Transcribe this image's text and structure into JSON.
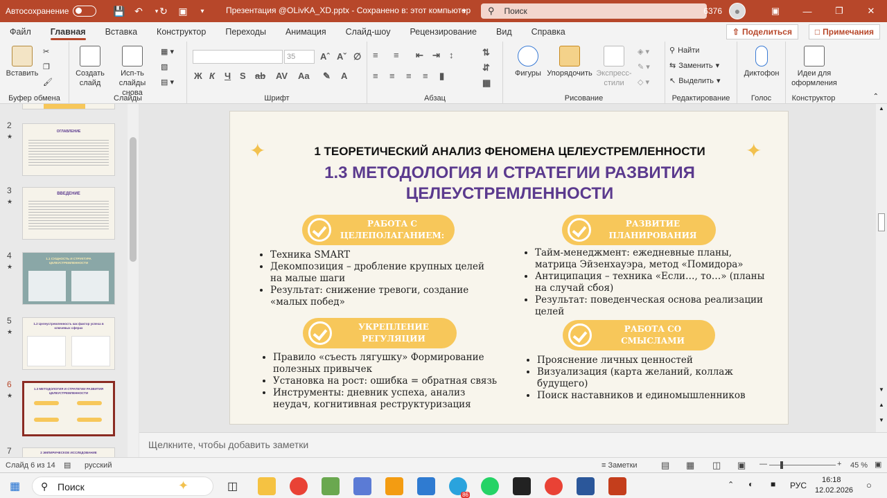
{
  "titlebar": {
    "autosave_label": "Автосохранение",
    "doc_title": "Презентация @OLivKA_XD.pptx  -  Сохранено в: этот компьютер",
    "search_placeholder": "Поиск",
    "user_id": "6376"
  },
  "menu": {
    "tabs": [
      "Файл",
      "Главная",
      "Вставка",
      "Конструктор",
      "Переходы",
      "Анимация",
      "Слайд-шоу",
      "Рецензирование",
      "Вид",
      "Справка"
    ],
    "share_label": "Поделиться",
    "notes_label": "Примечания"
  },
  "ribbon": {
    "clipboard": {
      "paste": "Вставить",
      "group": "Буфер обмена"
    },
    "slides": {
      "create": "Создать слайд",
      "reuse": "Исп-ть слайды снова",
      "group": "Слайды"
    },
    "font": {
      "size": "35",
      "group": "Шрифт"
    },
    "paragraph": {
      "group": "Абзац"
    },
    "drawing": {
      "shapes": "Фигуры",
      "arrange": "Упорядочить",
      "styles": "Экспресс-стили",
      "group": "Рисование"
    },
    "editing": {
      "find": "Найти",
      "replace": "Заменить",
      "select": "Выделить",
      "group": "Редактирование"
    },
    "voice": {
      "dictate": "Диктофон",
      "group": "Голос"
    },
    "designer": {
      "ideas": "Идеи для оформления",
      "group": "Конструктор"
    }
  },
  "thumbnails": [
    {
      "num": "2",
      "title": "ОГЛАВЛЕНИЕ"
    },
    {
      "num": "3",
      "title": "ВВЕДЕНИЕ"
    },
    {
      "num": "4",
      "title": "1.1 СУЩНОСТЬ И СТРУКТУРА ЦЕЛЕУСТРЕМЛЕННОСТИ"
    },
    {
      "num": "5",
      "title": "1.2 Целеустремленность как фактор успеха в ключевых сферах"
    },
    {
      "num": "6",
      "title": "1.3 МЕТОДОЛОГИЯ И СТРАТЕГИИ РАЗВИТИЯ ЦЕЛЕУСТРЕМЛЕННОСТИ"
    },
    {
      "num": "7",
      "title": "2 ЭМПИРИЧЕСКОЕ ИССЛЕДОВАНИЕ"
    }
  ],
  "slide": {
    "heading": "1 ТЕОРЕТИЧЕСКИЙ АНАЛИЗ ФЕНОМЕНА ЦЕЛЕУСТРЕМЛЕННОСТИ",
    "subheading_line1": "1.3 МЕТОДОЛОГИЯ И СТРАТЕГИИ РАЗВИТИЯ",
    "subheading_line2": "ЦЕЛЕУСТРЕМЛЕННОСТИ",
    "blocks": [
      {
        "title_l1": "РАБОТА С",
        "title_l2": "ЦЕЛЕПОЛАГАНИЕМ:",
        "items": [
          "Техника SMART",
          "Декомпозиция – дробление крупных целей на малые шаги",
          "Результат: снижение тревоги, создание «малых побед»"
        ]
      },
      {
        "title_l1": "РАЗВИТИЕ",
        "title_l2": "ПЛАНИРОВАНИЯ",
        "items": [
          "Тайм-менеджмент: ежедневные планы, матрица Эйзенхауэра, метод «Помидора»",
          "Антиципация – техника «Если…, то…» (планы на случай сбоя)",
          "Результат: поведенческая основа реализации целей"
        ]
      },
      {
        "title_l1": "УКРЕПЛЕНИЕ",
        "title_l2": "РЕГУЛЯЦИИ",
        "items": [
          "Правило «съесть лягушку» Формирование полезных привычек",
          "Установка на рост: ошибка = обратная связь",
          "Инструменты: дневник успеха, анализ неудач, когнитивная реструктуризация"
        ]
      },
      {
        "title_l1": "РАБОТА СО",
        "title_l2": "СМЫСЛАМИ",
        "items": [
          "Прояснение личных ценностей",
          "Визуализация (карта желаний, коллаж будущего)",
          "Поиск наставников и единомышленников"
        ]
      }
    ]
  },
  "notes_placeholder": "Щелкните, чтобы добавить заметки",
  "status": {
    "slide_counter": "Слайд 6 из 14",
    "language": "русский",
    "notes_toggle": "Заметки",
    "zoom": "45 %"
  },
  "taskbar": {
    "search": "Поиск",
    "lang": "РУС",
    "time": "16:18",
    "date": "12.02.2026",
    "telegram_badge": "86"
  },
  "colors": {
    "accent": "#b7472a",
    "pill": "#f7c75a",
    "purple": "#5b3a8e"
  }
}
